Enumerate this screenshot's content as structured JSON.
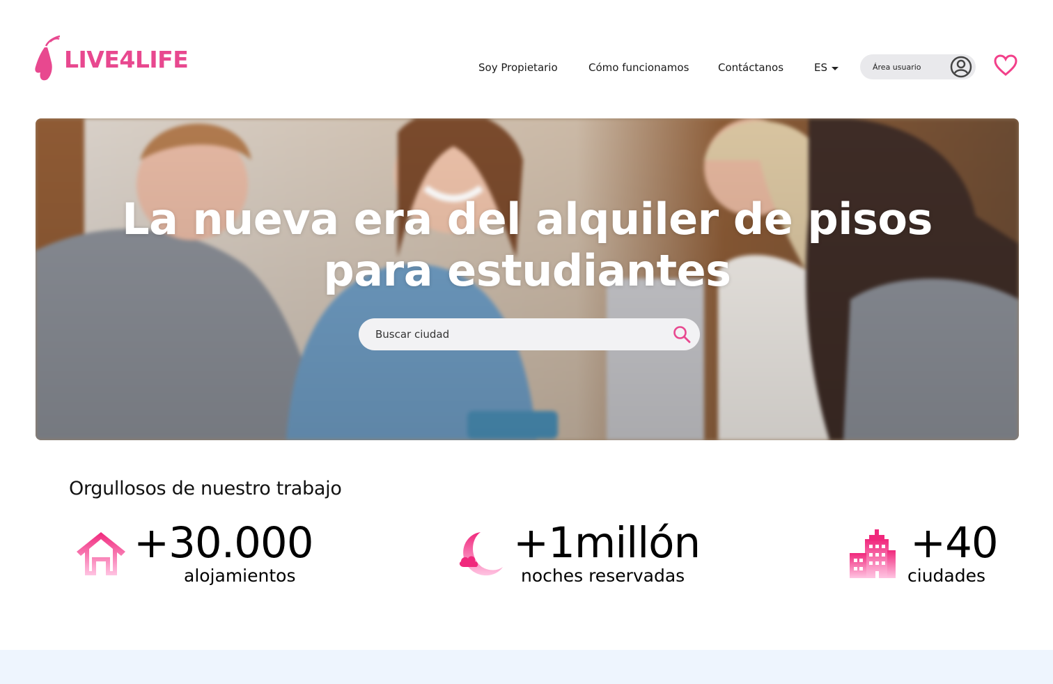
{
  "brand": {
    "name": "LIVE4LIFE",
    "color": "#e8488f"
  },
  "nav": {
    "items": [
      "Soy Propietario",
      "Cómo funcionamos",
      "Contáctanos"
    ],
    "language": "ES",
    "user_area_label": "Área usuario"
  },
  "hero": {
    "title_line1": "La nueva era del alquiler de pisos",
    "title_line2": "para estudiantes",
    "search_placeholder": "Buscar ciudad"
  },
  "stats": {
    "title": "Orgullosos de nuestro trabajo",
    "items": [
      {
        "icon": "house-icon",
        "value": "+30.000",
        "label": "alojamientos"
      },
      {
        "icon": "moon-icon",
        "value": "+1millón",
        "label": "noches reservadas"
      },
      {
        "icon": "buildings-icon",
        "value": "+40",
        "label": "ciudades"
      }
    ]
  },
  "colors": {
    "accent": "#e8488f",
    "accent_light": "#ff8ec5",
    "footer_band": "#eef5fe"
  }
}
